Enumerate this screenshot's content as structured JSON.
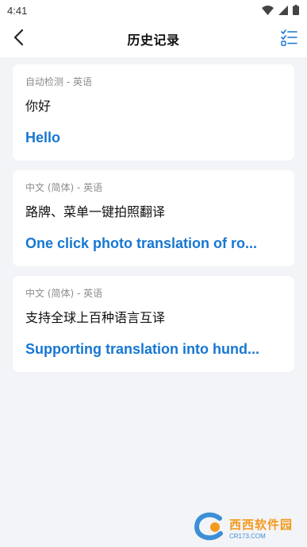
{
  "status_bar": {
    "time": "4:41",
    "icons": [
      "wifi-icon",
      "signal-icon",
      "battery-icon"
    ]
  },
  "header": {
    "title": "历史记录",
    "back_icon": "chevron-left-icon",
    "action_icon": "list-check-icon"
  },
  "history": [
    {
      "lang": "自动检测 - 英语",
      "source": "你好",
      "result": "Hello"
    },
    {
      "lang": "中文 (简体) - 英语",
      "source": "路牌、菜单一键拍照翻译",
      "result": "One click photo translation of ro..."
    },
    {
      "lang": "中文 (简体) - 英语",
      "source": "支持全球上百种语言互译",
      "result": "Supporting translation into hund..."
    }
  ],
  "watermark": {
    "text": "西西软件园",
    "sub": "CR173.COM"
  },
  "colors": {
    "accent": "#1677d2",
    "background": "#f3f4f7",
    "card": "#ffffff"
  }
}
